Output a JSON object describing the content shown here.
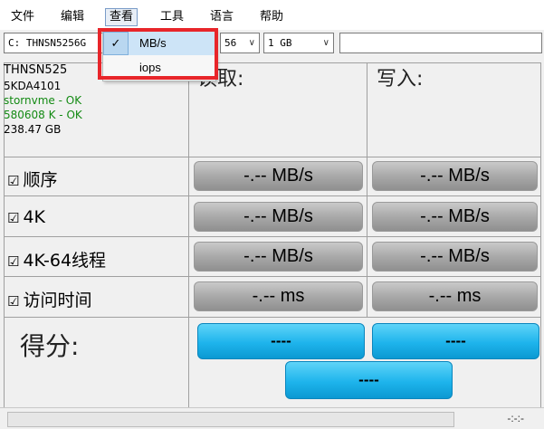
{
  "menu": {
    "file": "文件",
    "edit": "编辑",
    "view": "查看",
    "tools": "工具",
    "language": "语言",
    "help": "帮助"
  },
  "toolbar": {
    "drive": "C: THNSN5256G",
    "passes": "56",
    "size": "1 GB",
    "path": ""
  },
  "view_menu": {
    "items": [
      {
        "label": "MB/s",
        "checked": true
      },
      {
        "label": "iops",
        "checked": false
      }
    ],
    "check_glyph": "✓"
  },
  "drive_info": {
    "model_line1": "THNSN525",
    "model_line2": "5KDA4101",
    "driver": "stornvme - OK",
    "align": "580608 K - OK",
    "capacity": "238.47 GB"
  },
  "columns": {
    "read": "读取:",
    "write": "写入:"
  },
  "rows": [
    {
      "checkbox": "☑",
      "label": "顺序",
      "read": "-.-- MB/s",
      "write": "-.-- MB/s"
    },
    {
      "checkbox": "☑",
      "label": "4K",
      "read": "-.-- MB/s",
      "write": "-.-- MB/s"
    },
    {
      "checkbox": "☑",
      "label": "4K-64线程",
      "read": "-.-- MB/s",
      "write": "-.-- MB/s"
    },
    {
      "checkbox": "☑",
      "label": "访问时间",
      "read": "-.-- ms",
      "write": "-.-- ms"
    }
  ],
  "score": {
    "label": "得分:",
    "read": "----",
    "write": "----",
    "total": "----"
  },
  "status": {
    "elapsed": "-:-:-",
    "progress": 0
  },
  "colors": {
    "highlight": "#e8252a",
    "ok_text": "#138a13",
    "score_button": "#1eb4ec"
  }
}
